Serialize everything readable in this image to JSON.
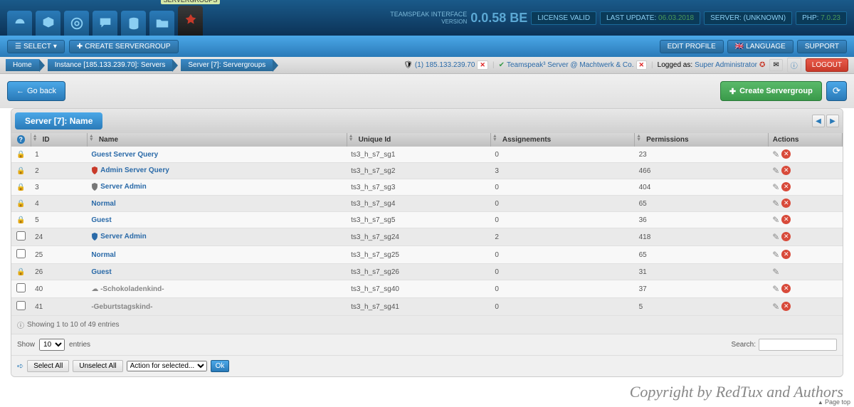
{
  "header": {
    "product_name": "TEAMSPEAK INTERFACE",
    "version_label": "VERSION",
    "version": "0.0.58 BE",
    "license": "LICENSE VALID",
    "last_update_label": "LAST UPDATE:",
    "last_update_value": "06.03.2018",
    "server_label": "SERVER:",
    "server_value": "(UNKNOWN)",
    "php_label": "PHP:",
    "php_value": "7.0.23",
    "active_tab_label": "SERVERGROUPS"
  },
  "toolbar": {
    "select_label": "SELECT",
    "create_label": "CREATE SERVERGROUP",
    "edit_profile": "EDIT PROFILE",
    "language": "LANGUAGE",
    "support": "SUPPORT"
  },
  "breadcrumb": {
    "items": [
      "Home",
      "Instance [185.133.239.70]: Servers",
      "Server [7]: Servergroups"
    ],
    "instance_link": "(1) 185.133.239.70",
    "server_link": "Teamspeak³ Server @ Machtwerk & Co.",
    "logged_label": "Logged as:",
    "logged_user": "Super Administrator",
    "logout": "LOGOUT"
  },
  "actions": {
    "go_back": "Go back",
    "create_servergroup": "Create Servergroup"
  },
  "panel": {
    "title": "Server [7]: Name",
    "columns": {
      "id": "ID",
      "name": "Name",
      "unique_id": "Unique Id",
      "assignments": "Assignements",
      "permissions": "Permissions",
      "actions": "Actions"
    },
    "rows": [
      {
        "locked": true,
        "id": "1",
        "name": "Guest Server Query",
        "icon": "",
        "uid": "ts3_h_s7_sg1",
        "assign": "0",
        "perm": "23",
        "deletable": true,
        "name_class": ""
      },
      {
        "locked": true,
        "id": "2",
        "name": "Admin Server Query",
        "icon": "shield-red",
        "uid": "ts3_h_s7_sg2",
        "assign": "3",
        "perm": "466",
        "deletable": true,
        "name_class": ""
      },
      {
        "locked": true,
        "id": "3",
        "name": "Server Admin",
        "icon": "shield-grey",
        "uid": "ts3_h_s7_sg3",
        "assign": "0",
        "perm": "404",
        "deletable": true,
        "name_class": ""
      },
      {
        "locked": true,
        "id": "4",
        "name": "Normal",
        "icon": "",
        "uid": "ts3_h_s7_sg4",
        "assign": "0",
        "perm": "65",
        "deletable": true,
        "name_class": ""
      },
      {
        "locked": true,
        "id": "5",
        "name": "Guest",
        "icon": "",
        "uid": "ts3_h_s7_sg5",
        "assign": "0",
        "perm": "36",
        "deletable": true,
        "name_class": ""
      },
      {
        "locked": false,
        "id": "24",
        "name": "Server Admin",
        "icon": "shield-blue",
        "uid": "ts3_h_s7_sg24",
        "assign": "2",
        "perm": "418",
        "deletable": true,
        "name_class": ""
      },
      {
        "locked": false,
        "id": "25",
        "name": "Normal",
        "icon": "",
        "uid": "ts3_h_s7_sg25",
        "assign": "0",
        "perm": "65",
        "deletable": true,
        "name_class": ""
      },
      {
        "locked": true,
        "id": "26",
        "name": "Guest",
        "icon": "",
        "uid": "ts3_h_s7_sg26",
        "assign": "0",
        "perm": "31",
        "deletable": false,
        "name_class": ""
      },
      {
        "locked": false,
        "id": "40",
        "name": "-Schokoladenkind-",
        "icon": "cloud",
        "uid": "ts3_h_s7_sg40",
        "assign": "0",
        "perm": "37",
        "deletable": true,
        "name_class": "muted"
      },
      {
        "locked": false,
        "id": "41",
        "name": "-Geburtstagskind-",
        "icon": "",
        "uid": "ts3_h_s7_sg41",
        "assign": "0",
        "perm": "5",
        "deletable": true,
        "name_class": "muted"
      }
    ],
    "info": "Showing 1 to 10 of 49 entries",
    "show_label": "Show",
    "entries_label": "entries",
    "page_size": "10",
    "search_label": "Search:",
    "select_all": "Select All",
    "unselect_all": "Unselect All",
    "bulk_placeholder": "Action for selected...",
    "ok": "Ok"
  },
  "footer": {
    "copyright": "Copyright by RedTux and Authors",
    "page_top": "Page top"
  }
}
